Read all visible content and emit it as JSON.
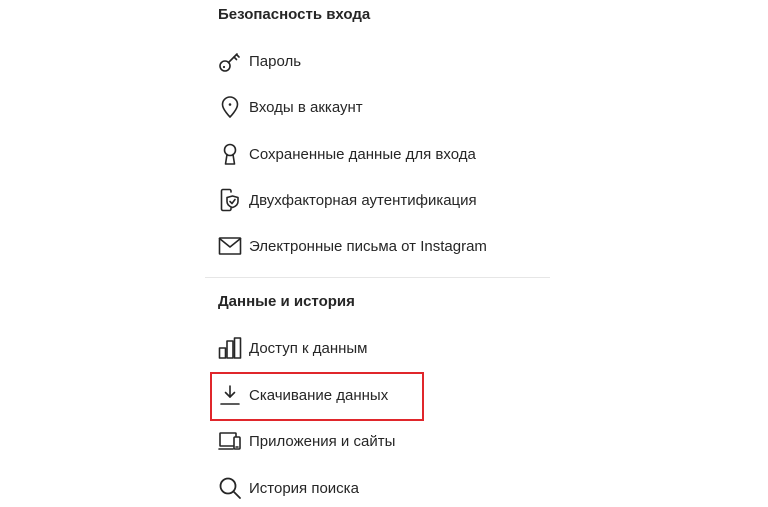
{
  "sections": {
    "login_security": {
      "title": "Безопасность входа",
      "items": [
        {
          "label": "Пароль",
          "icon": "key-icon"
        },
        {
          "label": "Входы в аккаунт",
          "icon": "location-pin-icon"
        },
        {
          "label": "Сохраненные данные для входа",
          "icon": "keyhole-icon"
        },
        {
          "label": "Двухфакторная аутентификация",
          "icon": "phone-shield-icon"
        },
        {
          "label": "Электронные письма от Instagram",
          "icon": "mail-icon"
        }
      ]
    },
    "data_history": {
      "title": "Данные и история",
      "items": [
        {
          "label": "Доступ к данным",
          "icon": "bar-chart-icon"
        },
        {
          "label": "Скачивание данных",
          "icon": "download-icon"
        },
        {
          "label": "Приложения и сайты",
          "icon": "devices-icon"
        },
        {
          "label": "История поиска",
          "icon": "search-icon"
        }
      ]
    }
  },
  "highlight": {
    "target": "Скачивание данных",
    "color": "#e0262b"
  },
  "colors": {
    "text": "#262626",
    "divider": "#e6e6e6"
  }
}
